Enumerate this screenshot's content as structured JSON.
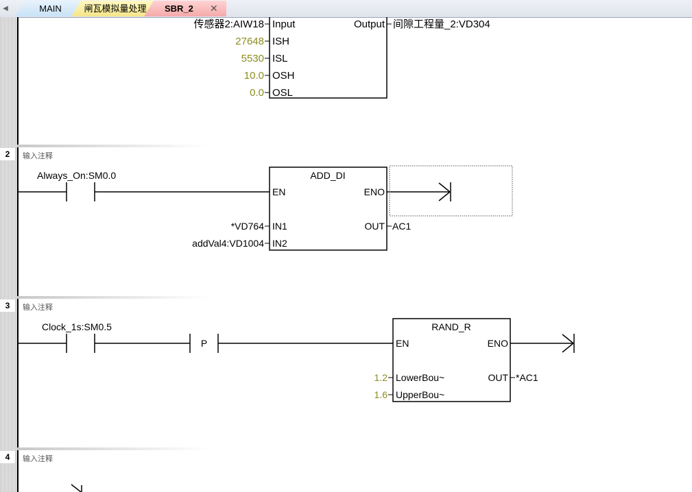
{
  "tabs": [
    {
      "label": "MAIN"
    },
    {
      "label": "闸瓦模拟量处理"
    },
    {
      "label": "SBR_2",
      "active": true
    }
  ],
  "colors": {
    "constant": "#8c8c1e",
    "rail": "#000000",
    "tab_active": "#f4a9a9",
    "tab_gas": "#f5e58a",
    "tab_main": "#c9e3f7"
  },
  "net1": {
    "params": [
      {
        "value": "传感器2:AIW18",
        "pin": "Input"
      },
      {
        "value": "27648",
        "pin": "ISH"
      },
      {
        "value": "5530",
        "pin": "ISL"
      },
      {
        "value": "10.0",
        "pin": "OSH"
      },
      {
        "value": "0.0",
        "pin": "OSL"
      }
    ],
    "output_pin": "Output",
    "output_value": "间隙工程量_2:VD304"
  },
  "net2": {
    "number": "2",
    "comment": "输入注释",
    "contact": "Always_On:SM0.0",
    "block": "ADD_DI",
    "en": "EN",
    "eno": "ENO",
    "in1_value": "*VD764",
    "in1_pin": "IN1",
    "in2_value": "addVal4:VD1004",
    "in2_pin": "IN2",
    "out_pin": "OUT",
    "out_value": "AC1"
  },
  "net3": {
    "number": "3",
    "comment": "输入注释",
    "contact": "Clock_1s:SM0.5",
    "edge": "P",
    "block": "RAND_R",
    "en": "EN",
    "eno": "ENO",
    "lower_value": "1.2",
    "lower_pin": "LowerBou~",
    "upper_value": "1.6",
    "upper_pin": "UpperBou~",
    "out_pin": "OUT",
    "out_value": "*AC1"
  },
  "net4": {
    "number": "4",
    "comment": "输入注释"
  }
}
